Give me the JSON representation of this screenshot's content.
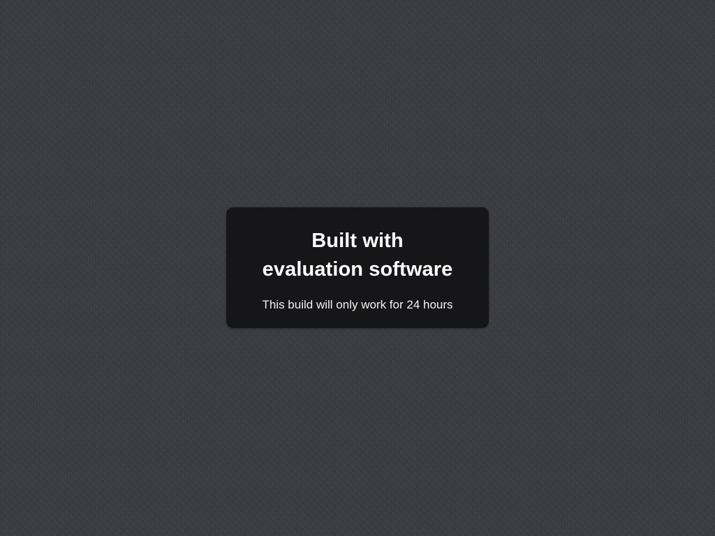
{
  "background": {
    "base_color": "#3a3c41",
    "texture": "linen"
  },
  "dialog": {
    "title_line_1": "Built with",
    "title_line_2": "evaluation software",
    "subtitle": "This build will only work for 24 hours",
    "background_color": "#141415",
    "text_color": "#ffffff"
  }
}
